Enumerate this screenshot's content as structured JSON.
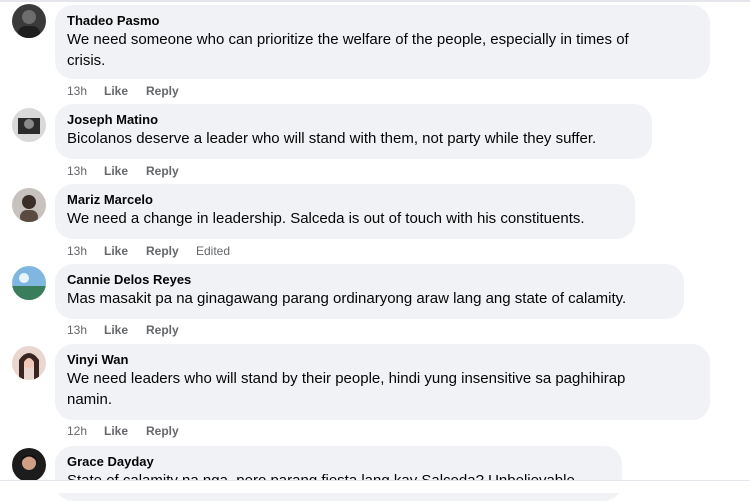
{
  "comments": [
    {
      "author": "Thadeo Pasmo",
      "text_line1": "We need someone who can prioritize the welfare of the people, especially in times of",
      "text_line2": "crisis.",
      "time": "13h",
      "like": "Like",
      "reply": "Reply"
    },
    {
      "author": "Joseph Matino",
      "text_line1": "Bicolanos deserve a leader who will stand with them, not party while they suffer.",
      "time": "13h",
      "like": "Like",
      "reply": "Reply"
    },
    {
      "author": "Mariz Marcelo",
      "text_line1": "We need a change in leadership. Salceda is out of touch with his constituents.",
      "time": "13h",
      "like": "Like",
      "reply": "Reply",
      "edited": "Edited"
    },
    {
      "author": "Cannie Delos Reyes",
      "text_line1": "Mas masakit pa na ginagawang parang ordinaryong araw lang ang state of calamity.",
      "time": "13h",
      "like": "Like",
      "reply": "Reply"
    },
    {
      "author": "Vinyi Wan",
      "text_line1": "We need leaders who will stand by their people, hindi yung insensitive sa paghihirap",
      "text_line2": "namin.",
      "time": "12h",
      "like": "Like",
      "reply": "Reply"
    },
    {
      "author": "Grace Dayday",
      "text_line1": "State of calamity na nga, pero parang fiesta lang kay Salceda? Unbelievable."
    }
  ],
  "colors": {
    "bubble": "#f0f2f5",
    "meta": "#65676b",
    "text": "#050505"
  }
}
